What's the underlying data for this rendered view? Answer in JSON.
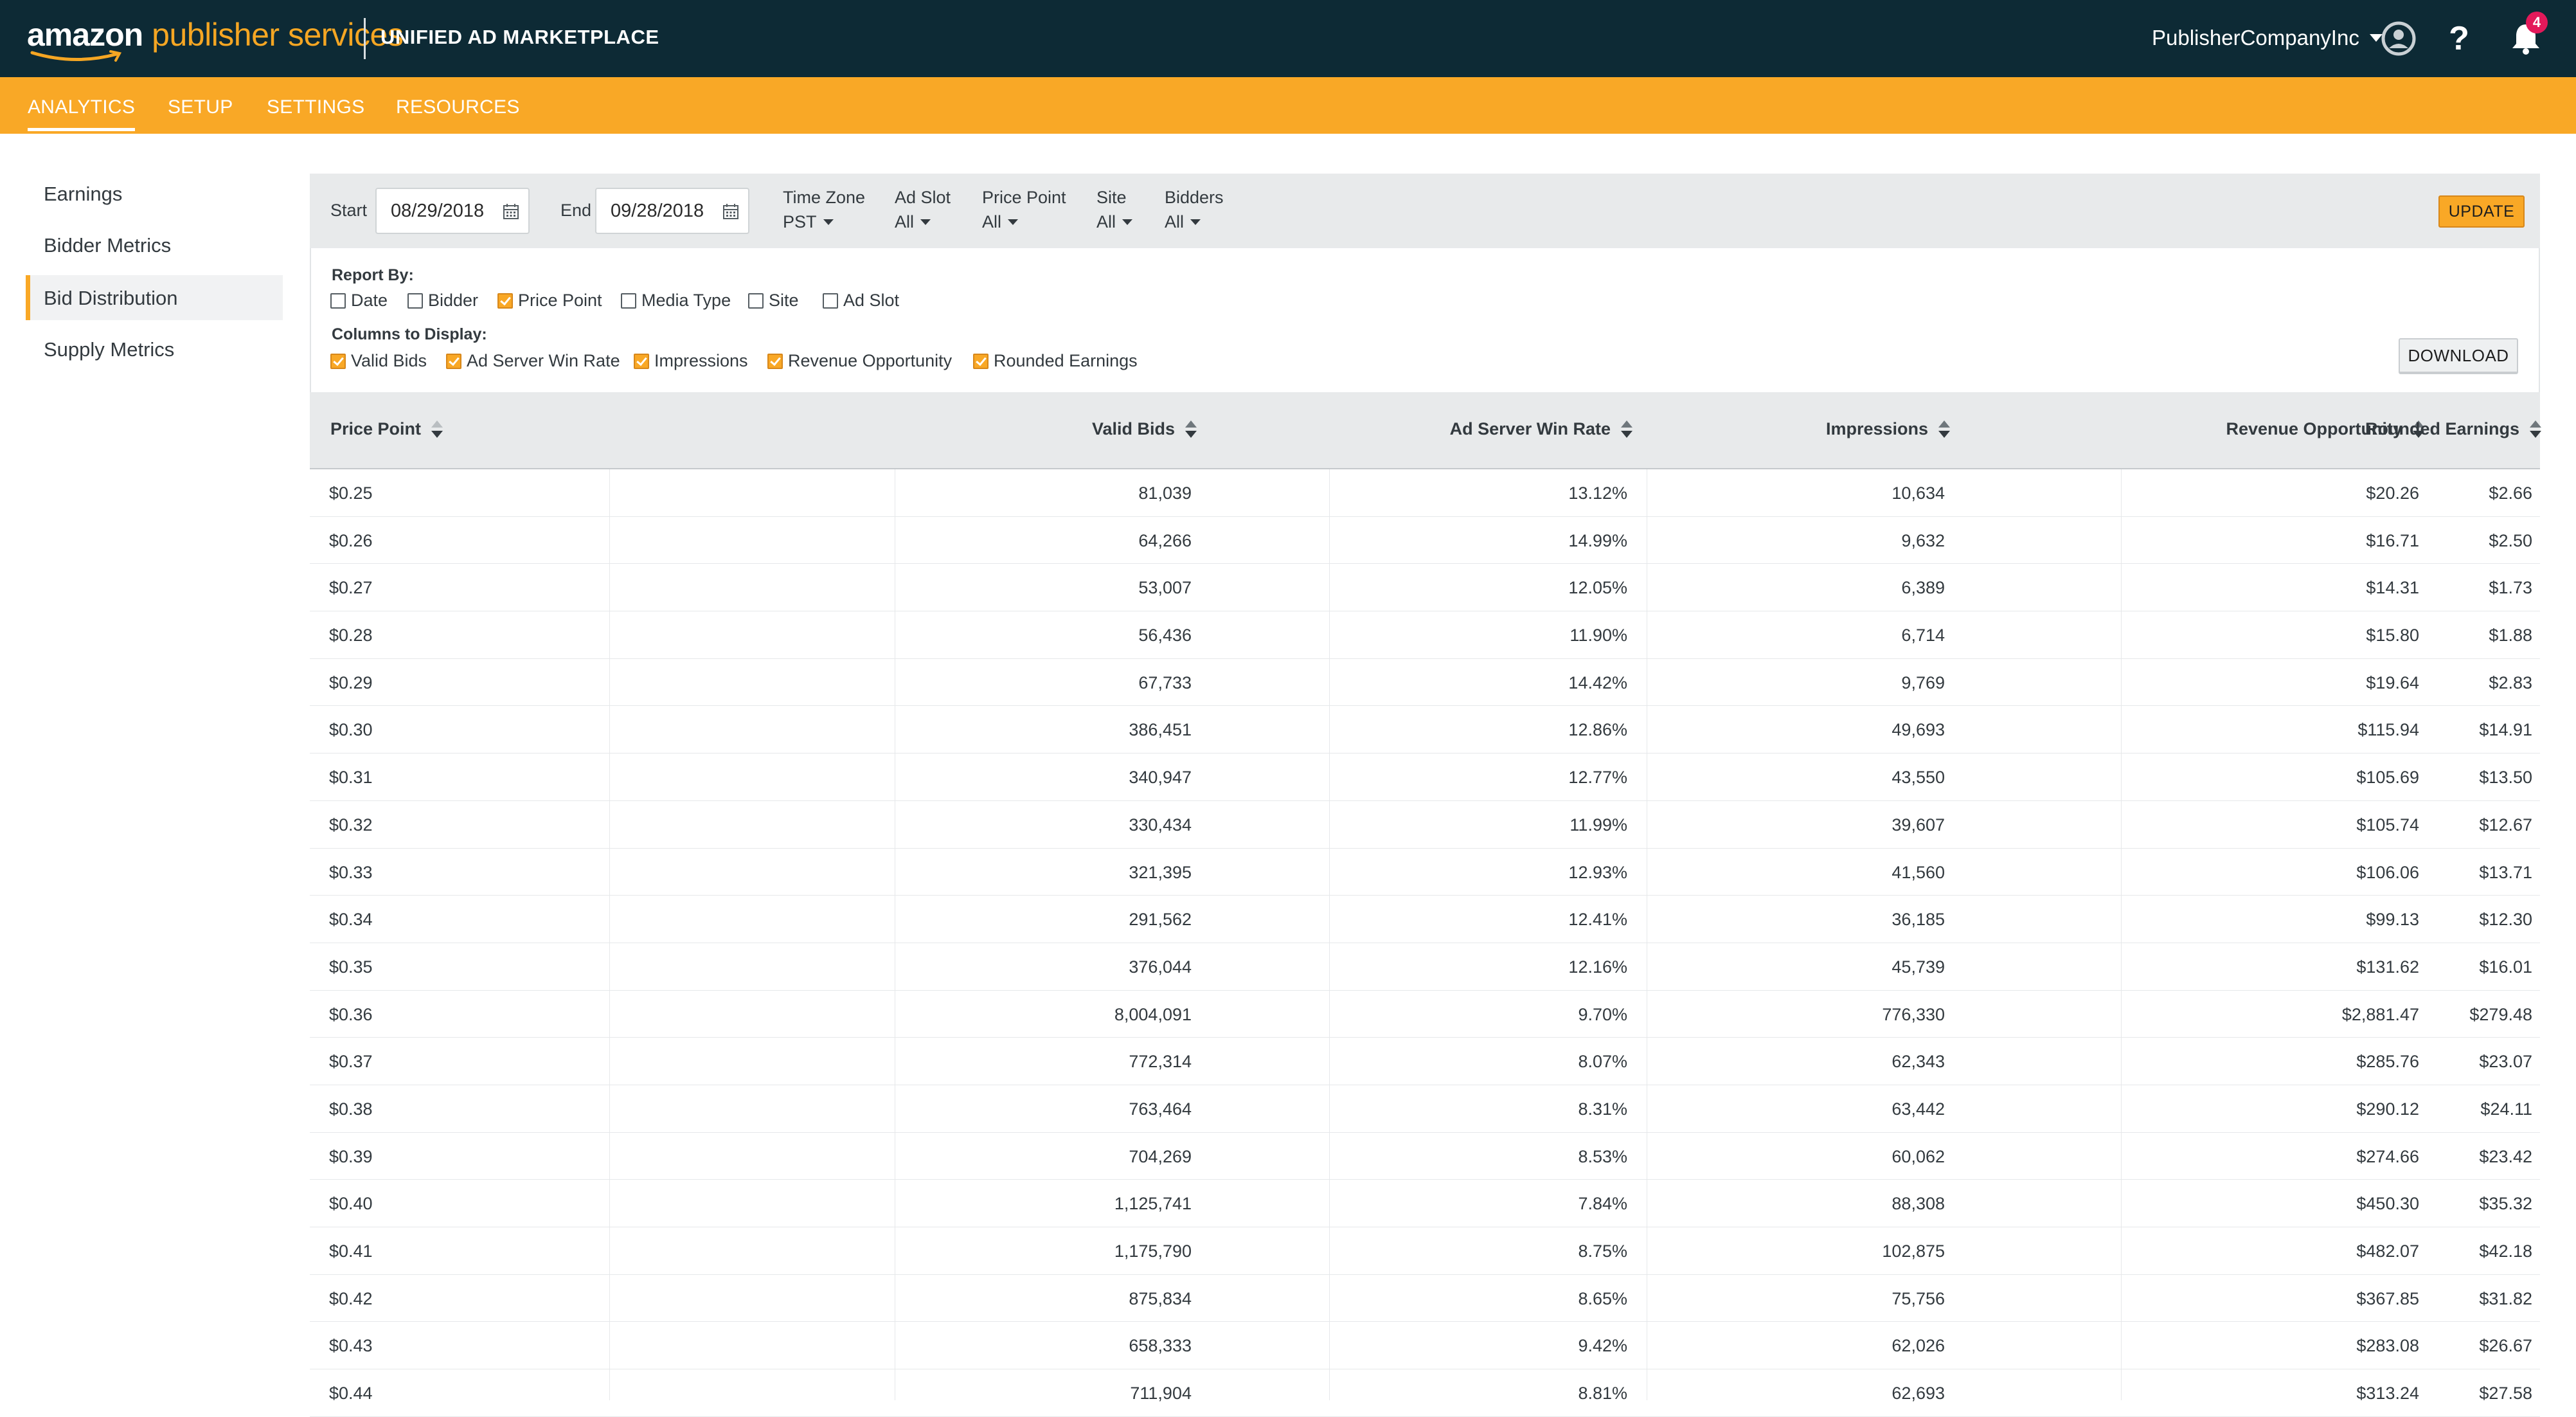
{
  "header": {
    "brand_amazon": "amazon",
    "brand_suffix": "publisher services",
    "product": "UNIFIED AD MARKETPLACE",
    "account": "PublisherCompanyInc",
    "notification_count": "4",
    "help_glyph": "?",
    "icons": [
      "user-circle-icon",
      "help-icon",
      "bell-icon"
    ]
  },
  "nav": {
    "tabs": [
      {
        "label": "ANALYTICS",
        "active": true
      },
      {
        "label": "SETUP"
      },
      {
        "label": "SETTINGS"
      },
      {
        "label": "RESOURCES"
      }
    ]
  },
  "sidebar": {
    "items": [
      {
        "label": "Earnings"
      },
      {
        "label": "Bidder Metrics"
      },
      {
        "label": "Bid Distribution",
        "active": true
      },
      {
        "label": "Supply Metrics"
      }
    ]
  },
  "filters": {
    "start_label": "Start",
    "start_value": "08/29/2018",
    "end_label": "End",
    "end_value": "09/28/2018",
    "timezone_label": "Time Zone",
    "timezone_value": "PST",
    "adslot_label": "Ad Slot",
    "adslot_value": "All",
    "pricepoint_label": "Price Point",
    "pricepoint_value": "All",
    "site_label": "Site",
    "site_value": "All",
    "bidders_label": "Bidders",
    "bidders_value": "All",
    "update_label": "UPDATE"
  },
  "report_by": {
    "title": "Report By:",
    "options": [
      {
        "label": "Date",
        "checked": false
      },
      {
        "label": "Bidder",
        "checked": false
      },
      {
        "label": "Price Point",
        "checked": true
      },
      {
        "label": "Media Type",
        "checked": false
      },
      {
        "label": "Site",
        "checked": false
      },
      {
        "label": "Ad Slot",
        "checked": false
      }
    ]
  },
  "columns_to_display": {
    "title": "Columns to Display:",
    "options": [
      {
        "label": "Valid Bids",
        "checked": true
      },
      {
        "label": "Ad Server Win Rate",
        "checked": true
      },
      {
        "label": "Impressions",
        "checked": true
      },
      {
        "label": "Revenue Opportunity",
        "checked": true
      },
      {
        "label": "Rounded Earnings",
        "checked": true
      }
    ],
    "download_label": "DOWNLOAD"
  },
  "table": {
    "headers": [
      "Price Point",
      "Valid Bids",
      "Ad Server Win Rate",
      "Impressions",
      "Revenue Opportunity",
      "Rounded Earnings"
    ],
    "rows": [
      [
        "$0.25",
        "81,039",
        "13.12%",
        "10,634",
        "$20.26",
        "$2.66"
      ],
      [
        "$0.26",
        "64,266",
        "14.99%",
        "9,632",
        "$16.71",
        "$2.50"
      ],
      [
        "$0.27",
        "53,007",
        "12.05%",
        "6,389",
        "$14.31",
        "$1.73"
      ],
      [
        "$0.28",
        "56,436",
        "11.90%",
        "6,714",
        "$15.80",
        "$1.88"
      ],
      [
        "$0.29",
        "67,733",
        "14.42%",
        "9,769",
        "$19.64",
        "$2.83"
      ],
      [
        "$0.30",
        "386,451",
        "12.86%",
        "49,693",
        "$115.94",
        "$14.91"
      ],
      [
        "$0.31",
        "340,947",
        "12.77%",
        "43,550",
        "$105.69",
        "$13.50"
      ],
      [
        "$0.32",
        "330,434",
        "11.99%",
        "39,607",
        "$105.74",
        "$12.67"
      ],
      [
        "$0.33",
        "321,395",
        "12.93%",
        "41,560",
        "$106.06",
        "$13.71"
      ],
      [
        "$0.34",
        "291,562",
        "12.41%",
        "36,185",
        "$99.13",
        "$12.30"
      ],
      [
        "$0.35",
        "376,044",
        "12.16%",
        "45,739",
        "$131.62",
        "$16.01"
      ],
      [
        "$0.36",
        "8,004,091",
        "9.70%",
        "776,330",
        "$2,881.47",
        "$279.48"
      ],
      [
        "$0.37",
        "772,314",
        "8.07%",
        "62,343",
        "$285.76",
        "$23.07"
      ],
      [
        "$0.38",
        "763,464",
        "8.31%",
        "63,442",
        "$290.12",
        "$24.11"
      ],
      [
        "$0.39",
        "704,269",
        "8.53%",
        "60,062",
        "$274.66",
        "$23.42"
      ],
      [
        "$0.40",
        "1,125,741",
        "7.84%",
        "88,308",
        "$450.30",
        "$35.32"
      ],
      [
        "$0.41",
        "1,175,790",
        "8.75%",
        "102,875",
        "$482.07",
        "$42.18"
      ],
      [
        "$0.42",
        "875,834",
        "8.65%",
        "75,756",
        "$367.85",
        "$31.82"
      ],
      [
        "$0.43",
        "658,333",
        "9.42%",
        "62,026",
        "$283.08",
        "$26.67"
      ],
      [
        "$0.44",
        "711,904",
        "8.81%",
        "62,693",
        "$313.24",
        "$27.58"
      ]
    ]
  },
  "colors": {
    "header_bg": "#0d2a35",
    "accent": "#f9a826",
    "badge": "#e3195a"
  }
}
